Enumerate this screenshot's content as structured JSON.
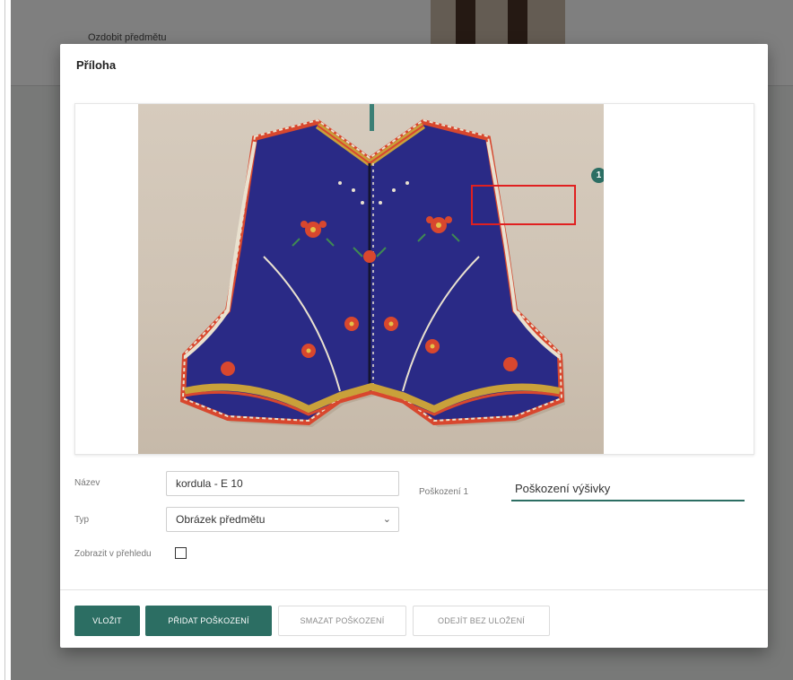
{
  "background": {
    "row_text": "Ozdobit předmětu"
  },
  "modal": {
    "title": "Příloha",
    "damage_marker_number": "1",
    "fields": {
      "name_label": "Název",
      "name_value": "kordula - E 10",
      "type_label": "Typ",
      "type_value": "Obrázek předmětu",
      "damage_label": "Poškození 1",
      "damage_value": "Poškození výšivky",
      "show_label": "Zobrazit v přehledu"
    },
    "buttons": {
      "insert": "Vložit",
      "add_damage": "Přidat poškození",
      "delete_damage": "Smazat poškození",
      "close_without_saving": "Odejít bez uložení"
    }
  },
  "colors": {
    "accent": "#2c6e63",
    "damage_box": "#e02020",
    "vest_blue": "#2a2a86",
    "embroidery_red": "#d8472e"
  },
  "icons": {
    "select": "chevron-down-icon",
    "marker": "damage-marker-icon"
  }
}
